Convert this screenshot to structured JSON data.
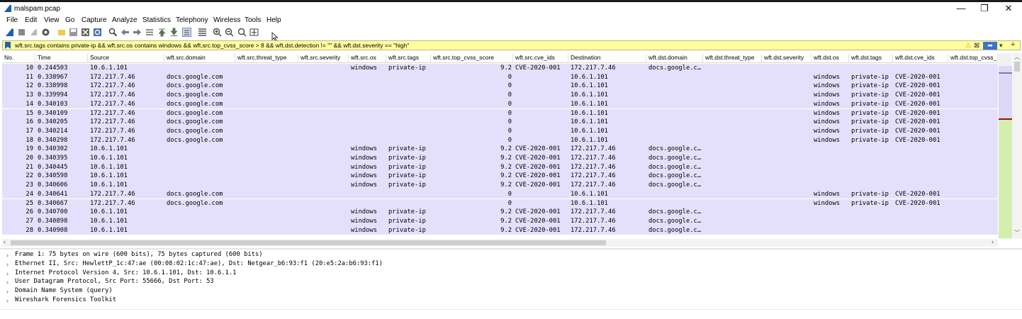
{
  "window": {
    "title": "malspam.pcap",
    "minimize": "—",
    "maximize": "❐",
    "close": "✕"
  },
  "menu": [
    "File",
    "Edit",
    "View",
    "Go",
    "Capture",
    "Analyze",
    "Statistics",
    "Telephony",
    "Wireless",
    "Tools",
    "Help"
  ],
  "toolbar_icons": [
    "shark-fin-start-icon",
    "stop-icon",
    "restart-icon",
    "options-gear-icon",
    "open-folder-icon",
    "save-icon",
    "close-file-icon",
    "reload-icon",
    "find-icon",
    "go-back-icon",
    "go-forward-icon",
    "go-to-packet-icon",
    "first-packet-icon",
    "last-packet-icon",
    "autoscroll-icon",
    "colorize-icon",
    "zoom-in-icon",
    "zoom-out-icon",
    "zoom-normal-icon",
    "resize-columns-icon"
  ],
  "filter": {
    "text": "wft.src.tags contains private-ip && wft.src.os contains windows && wft.src.top_cvss_score > 8 && wft.dst.detection != \"\" && wft.dst.severity == \"high\"",
    "warning": "⚠",
    "clear": "⊠",
    "apply": "➡",
    "dropdown": "▾",
    "add": "+"
  },
  "columns": [
    "No.",
    "Time",
    "Source",
    "wft.src.domain",
    "wft.src.threat_type",
    "wft.src.severity",
    "wft.src.os",
    "wft.src.tags",
    "wft.src.top_cvss_score",
    "wft.src.cve_ids",
    "Destination",
    "wft.dst.domain",
    "wft.dst.threat_type",
    "wft.dst.severity",
    "wft.dst.os",
    "wft.dst.tags",
    "wft.dst.cve_ids",
    "wft.dst.top_cvss_"
  ],
  "packets": [
    [
      "10",
      "0.244503",
      "10.6.1.101",
      "",
      "",
      "",
      "windows",
      "private-ip",
      "9.2",
      "CVE-2020-001",
      "172.217.7.46",
      "docs.google.c…",
      "",
      "",
      "",
      "",
      "",
      ""
    ],
    [
      "11",
      "0.338967",
      "172.217.7.46",
      "docs.google.com",
      "",
      "",
      "",
      "",
      "0",
      "",
      "10.6.1.101",
      "",
      "",
      "",
      "windows",
      "private-ip",
      "CVE-2020-001",
      ""
    ],
    [
      "12",
      "0.338998",
      "172.217.7.46",
      "docs.google.com",
      "",
      "",
      "",
      "",
      "0",
      "",
      "10.6.1.101",
      "",
      "",
      "",
      "windows",
      "private-ip",
      "CVE-2020-001",
      ""
    ],
    [
      "13",
      "0.339994",
      "172.217.7.46",
      "docs.google.com",
      "",
      "",
      "",
      "",
      "0",
      "",
      "10.6.1.101",
      "",
      "",
      "",
      "windows",
      "private-ip",
      "CVE-2020-001",
      ""
    ],
    [
      "14",
      "0.340103",
      "172.217.7.46",
      "docs.google.com",
      "",
      "",
      "",
      "",
      "0",
      "",
      "10.6.1.101",
      "",
      "",
      "",
      "windows",
      "private-ip",
      "CVE-2020-001",
      ""
    ],
    [
      "15",
      "0.340109",
      "172.217.7.46",
      "docs.google.com",
      "",
      "",
      "",
      "",
      "0",
      "",
      "10.6.1.101",
      "",
      "",
      "",
      "windows",
      "private-ip",
      "CVE-2020-001",
      ""
    ],
    [
      "16",
      "0.340205",
      "172.217.7.46",
      "docs.google.com",
      "",
      "",
      "",
      "",
      "0",
      "",
      "10.6.1.101",
      "",
      "",
      "",
      "windows",
      "private-ip",
      "CVE-2020-001",
      ""
    ],
    [
      "17",
      "0.340214",
      "172.217.7.46",
      "docs.google.com",
      "",
      "",
      "",
      "",
      "0",
      "",
      "10.6.1.101",
      "",
      "",
      "",
      "windows",
      "private-ip",
      "CVE-2020-001",
      ""
    ],
    [
      "18",
      "0.340298",
      "172.217.7.46",
      "docs.google.com",
      "",
      "",
      "",
      "",
      "0",
      "",
      "10.6.1.101",
      "",
      "",
      "",
      "windows",
      "private-ip",
      "CVE-2020-001",
      ""
    ],
    [
      "19",
      "0.340302",
      "10.6.1.101",
      "",
      "",
      "",
      "windows",
      "private-ip",
      "9.2",
      "CVE-2020-001",
      "172.217.7.46",
      "docs.google.c…",
      "",
      "",
      "",
      "",
      "",
      ""
    ],
    [
      "20",
      "0.340395",
      "10.6.1.101",
      "",
      "",
      "",
      "windows",
      "private-ip",
      "9.2",
      "CVE-2020-001",
      "172.217.7.46",
      "docs.google.c…",
      "",
      "",
      "",
      "",
      "",
      ""
    ],
    [
      "21",
      "0.340445",
      "10.6.1.101",
      "",
      "",
      "",
      "windows",
      "private-ip",
      "9.2",
      "CVE-2020-001",
      "172.217.7.46",
      "docs.google.c…",
      "",
      "",
      "",
      "",
      "",
      ""
    ],
    [
      "22",
      "0.340598",
      "10.6.1.101",
      "",
      "",
      "",
      "windows",
      "private-ip",
      "9.2",
      "CVE-2020-001",
      "172.217.7.46",
      "docs.google.c…",
      "",
      "",
      "",
      "",
      "",
      ""
    ],
    [
      "23",
      "0.340606",
      "10.6.1.101",
      "",
      "",
      "",
      "windows",
      "private-ip",
      "9.2",
      "CVE-2020-001",
      "172.217.7.46",
      "docs.google.c…",
      "",
      "",
      "",
      "",
      "",
      ""
    ],
    [
      "24",
      "0.340641",
      "172.217.7.46",
      "docs.google.com",
      "",
      "",
      "",
      "",
      "0",
      "",
      "10.6.1.101",
      "",
      "",
      "",
      "windows",
      "private-ip",
      "CVE-2020-001",
      ""
    ],
    [
      "25",
      "0.340667",
      "172.217.7.46",
      "docs.google.com",
      "",
      "",
      "",
      "",
      "0",
      "",
      "10.6.1.101",
      "",
      "",
      "",
      "windows",
      "private-ip",
      "CVE-2020-001",
      ""
    ],
    [
      "26",
      "0.340700",
      "10.6.1.101",
      "",
      "",
      "",
      "windows",
      "private-ip",
      "9.2",
      "CVE-2020-001",
      "172.217.7.46",
      "docs.google.c…",
      "",
      "",
      "",
      "",
      "",
      ""
    ],
    [
      "27",
      "0.340898",
      "10.6.1.101",
      "",
      "",
      "",
      "windows",
      "private-ip",
      "9.2",
      "CVE-2020-001",
      "172.217.7.46",
      "docs.google.c…",
      "",
      "",
      "",
      "",
      "",
      ""
    ],
    [
      "28",
      "0.340908",
      "10.6.1.101",
      "",
      "",
      "",
      "windows",
      "private-ip",
      "9.2",
      "CVE-2020-001",
      "172.217.7.46",
      "docs.google.c…",
      "",
      "",
      "",
      "",
      "",
      ""
    ]
  ],
  "details": [
    "Frame 1: 75 bytes on wire (600 bits), 75 bytes captured (600 bits)",
    "Ethernet II, Src: HewlettP_1c:47:ae (00:08:02:1c:47:ae), Dst: Netgear_b6:93:f1 (20:e5:2a:b6:93:f1)",
    "Internet Protocol Version 4, Src: 10.6.1.101, Dst: 10.6.1.1",
    "User Datagram Protocol, Src Port: 55666, Dst Port: 53",
    "Domain Name System (query)",
    "Wireshark Forensics Toolkit"
  ],
  "colors": {
    "row_bg": "#e4e0fb",
    "filter_bg": "#ffff9e",
    "minimap_green": "#d4eeb0",
    "minimap_mark": "#9b1010"
  }
}
